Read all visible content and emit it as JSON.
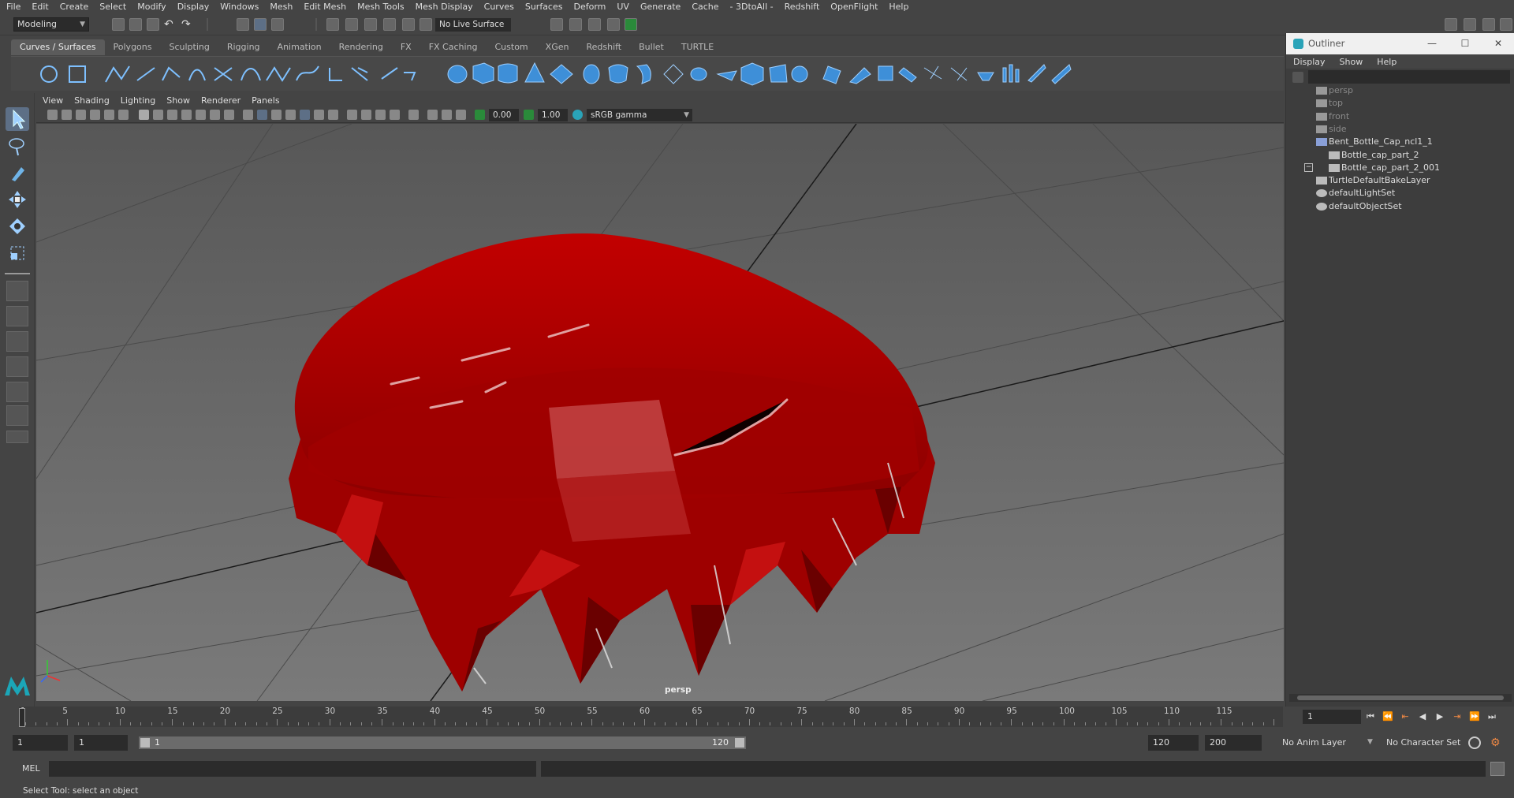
{
  "menubar": {
    "items": [
      "File",
      "Edit",
      "Create",
      "Select",
      "Modify",
      "Display",
      "Windows",
      "Mesh",
      "Edit Mesh",
      "Mesh Tools",
      "Mesh Display",
      "Curves",
      "Surfaces",
      "Deform",
      "UV",
      "Generate",
      "Cache",
      "- 3DtoAll -",
      "Redshift",
      "OpenFlight",
      "Help"
    ]
  },
  "statusline": {
    "mode": "Modeling",
    "live_surface": "No Live Surface"
  },
  "shelf": {
    "tabs": [
      "Curves / Surfaces",
      "Polygons",
      "Sculpting",
      "Rigging",
      "Animation",
      "Rendering",
      "FX",
      "FX Caching",
      "Custom",
      "XGen",
      "Redshift",
      "Bullet",
      "TURTLE"
    ],
    "active_tab": "Curves / Surfaces"
  },
  "panel": {
    "menu": [
      "View",
      "Shading",
      "Lighting",
      "Show",
      "Renderer",
      "Panels"
    ],
    "exposure": "0.00",
    "gamma": "1.00",
    "color_space": "sRGB gamma",
    "camera_label": "persp"
  },
  "colors": {
    "cap_red": "#b40000",
    "viewport_bg": "#6b6b6b",
    "accent": "#5d6f86"
  },
  "outliner": {
    "title": "Outliner",
    "menu": [
      "Display",
      "Show",
      "Help"
    ],
    "items": [
      {
        "label": "persp",
        "dim": true
      },
      {
        "label": "top",
        "dim": true
      },
      {
        "label": "front",
        "dim": true
      },
      {
        "label": "side",
        "dim": true
      },
      {
        "label": "Bent_Bottle_Cap_ncl1_1",
        "dim": false
      },
      {
        "label": "Bottle_cap_part_2",
        "dim": false
      },
      {
        "label": "Bottle_cap_part_2_001",
        "dim": false
      },
      {
        "label": "TurtleDefaultBakeLayer",
        "dim": false
      },
      {
        "label": "defaultLightSet",
        "dim": false
      },
      {
        "label": "defaultObjectSet",
        "dim": false
      }
    ]
  },
  "timeslider": {
    "labels": [
      "5",
      "10",
      "15",
      "20",
      "25",
      "30",
      "35",
      "40",
      "45",
      "50",
      "55",
      "60",
      "65",
      "70",
      "75",
      "80",
      "85",
      "90",
      "95",
      "100",
      "105",
      "110",
      "115"
    ],
    "start_label": "1",
    "current_frame": "1"
  },
  "rangeslider": {
    "start": "1",
    "playback_start": "1",
    "range_start": "1",
    "range_end": "120",
    "playback_end": "120",
    "end": "200",
    "anim_layer": "No Anim Layer",
    "character_set": "No Character Set"
  },
  "cmdline": {
    "label": "MEL"
  },
  "helpline": {
    "text": "Select Tool: select an object"
  }
}
